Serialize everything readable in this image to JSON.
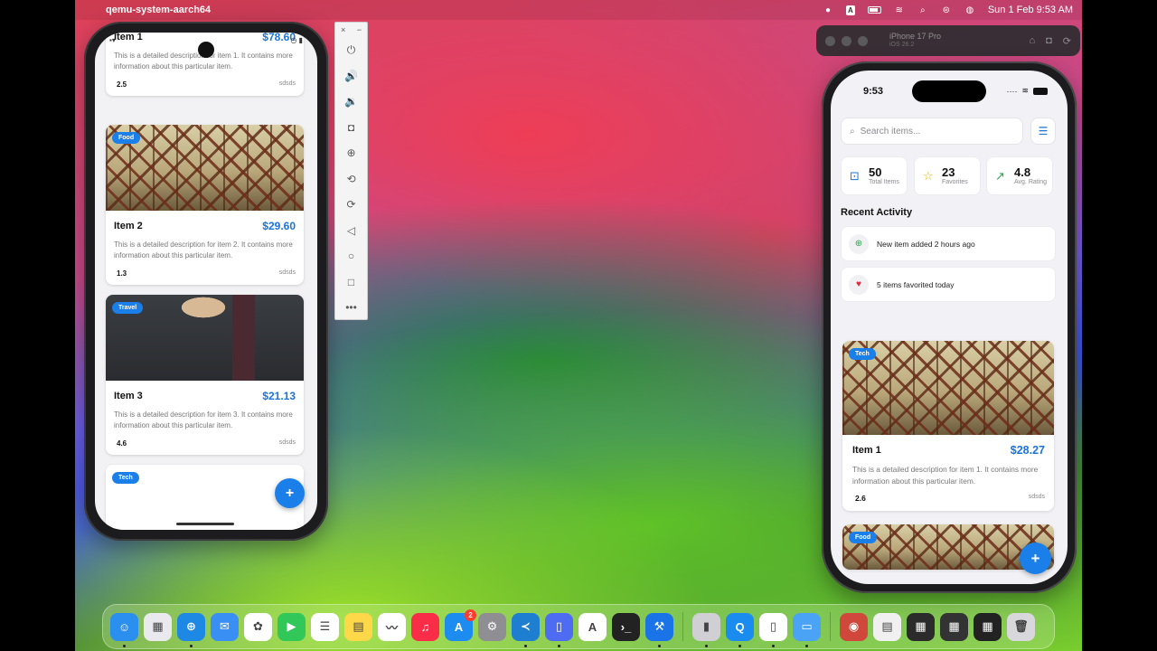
{
  "menubar": {
    "app_name": "qemu-system-aarch64",
    "input_badge": "A",
    "datetime": "Sun 1 Feb  9:53 AM"
  },
  "android": {
    "cards": [
      {
        "title": "Item 1",
        "price": "$78.60",
        "description": "This is a detailed description for item 1. It contains more information about this particular item.",
        "rating": "2.5",
        "subtitle": "sdsds"
      },
      {
        "tag": "Food",
        "title": "Item 2",
        "price": "$29.60",
        "description": "This is a detailed description for item 2. It contains more information about this particular item.",
        "rating": "1.3",
        "subtitle": "sdsds"
      },
      {
        "tag": "Travel",
        "title": "Item 3",
        "price": "$21.13",
        "description": "This is a detailed description for item 3. It contains more information about this particular item.",
        "rating": "4.6",
        "subtitle": "sdsds"
      },
      {
        "tag": "Tech"
      }
    ],
    "fab_label": "+"
  },
  "emulator_toolbar": {
    "close": "×",
    "minimize": "−",
    "buttons": [
      "power-icon",
      "volume-up-icon",
      "volume-down-icon",
      "camera-icon",
      "zoom-icon",
      "rotate-left-icon",
      "rotate-right-icon",
      "back-icon",
      "home-icon",
      "overview-icon",
      "more-icon"
    ]
  },
  "simulator": {
    "device_name": "iPhone 17 Pro",
    "os_version": "iOS 26.2"
  },
  "iphone": {
    "time": "9:53",
    "search": {
      "placeholder": "Search items..."
    },
    "stats": [
      {
        "value": "50",
        "label": "Total Items",
        "icon": "bag-icon",
        "color": "#1a74d9"
      },
      {
        "value": "23",
        "label": "Favorites",
        "icon": "star-icon",
        "color": "#e8b400"
      },
      {
        "value": "4.8",
        "label": "Avg. Rating",
        "icon": "trend-up-icon",
        "color": "#2ba84a"
      }
    ],
    "section_title": "Recent Activity",
    "activities": [
      {
        "text": "New item added 2 hours ago",
        "icon": "plus-circle-icon",
        "color": "#2ba84a"
      },
      {
        "text": "5 items favorited today",
        "icon": "heart-icon",
        "color": "#e0283c"
      }
    ],
    "cards": [
      {
        "tag": "Tech",
        "title": "Item 1",
        "price": "$28.27",
        "description": "This is a detailed description for item 1. It contains more information about this particular item.",
        "rating": "2.6",
        "subtitle": "sdsds"
      },
      {
        "tag": "Food"
      }
    ],
    "fab_label": "+"
  },
  "dock": {
    "apps": [
      {
        "name": "Finder",
        "color": "#2b8ff0",
        "glyph": "☺",
        "running": true
      },
      {
        "name": "Launchpad",
        "color": "#e9e9ee",
        "glyph": "▦"
      },
      {
        "name": "Safari",
        "color": "#1e88e5",
        "glyph": "⊕",
        "running": true
      },
      {
        "name": "Mail",
        "color": "#3a8ff5",
        "glyph": "✉"
      },
      {
        "name": "Photos",
        "color": "#ffffff",
        "glyph": "✿"
      },
      {
        "name": "FaceTime",
        "color": "#32c759",
        "glyph": "▶"
      },
      {
        "name": "Reminders",
        "color": "#ffffff",
        "glyph": "☰"
      },
      {
        "name": "Notes",
        "color": "#ffd84a",
        "glyph": "▤"
      },
      {
        "name": "Freeform",
        "color": "#ffffff",
        "glyph": "〰"
      },
      {
        "name": "Music",
        "color": "#fa2d48",
        "glyph": "♫"
      },
      {
        "name": "App Store",
        "color": "#1c8cf0",
        "glyph": "A",
        "badge": "2"
      },
      {
        "name": "System Settings",
        "color": "#8e8e93",
        "glyph": "⚙"
      },
      {
        "name": "Visual Studio Code",
        "color": "#1e7fd0",
        "glyph": "≺",
        "running": true
      },
      {
        "name": "Simulator",
        "color": "#4d6cf2",
        "glyph": "▯",
        "running": true
      },
      {
        "name": "Instruments",
        "color": "#ffffff",
        "glyph": "A"
      },
      {
        "name": "Terminal",
        "color": "#222222",
        "glyph": "›_"
      },
      {
        "name": "Xcode",
        "color": "#1a74e8",
        "glyph": "⚒",
        "running": true
      }
    ],
    "apps_secondary": [
      {
        "name": "Device Manager",
        "color": "#cfcfd4",
        "glyph": "▮",
        "running": true
      },
      {
        "name": "QEMU",
        "color": "#1a8cf0",
        "glyph": "Q",
        "running": true
      },
      {
        "name": "Android Emulator",
        "color": "#ffffff",
        "glyph": "▯",
        "running": true
      },
      {
        "name": "Screen Sharing",
        "color": "#4aa3f5",
        "glyph": "▭",
        "running": true
      }
    ],
    "recents": [
      {
        "name": "Photo",
        "color": "#d0473c",
        "glyph": "◉"
      },
      {
        "name": "Document",
        "color": "#f0f0f0",
        "glyph": "▤"
      },
      {
        "name": "Window 1",
        "color": "#2b2b2b",
        "glyph": "▦"
      },
      {
        "name": "Window 2",
        "color": "#333333",
        "glyph": "▦"
      },
      {
        "name": "Window 3",
        "color": "#222222",
        "glyph": "▦"
      },
      {
        "name": "Trash",
        "color": "#d8d8dc",
        "glyph": "🗑"
      }
    ]
  }
}
